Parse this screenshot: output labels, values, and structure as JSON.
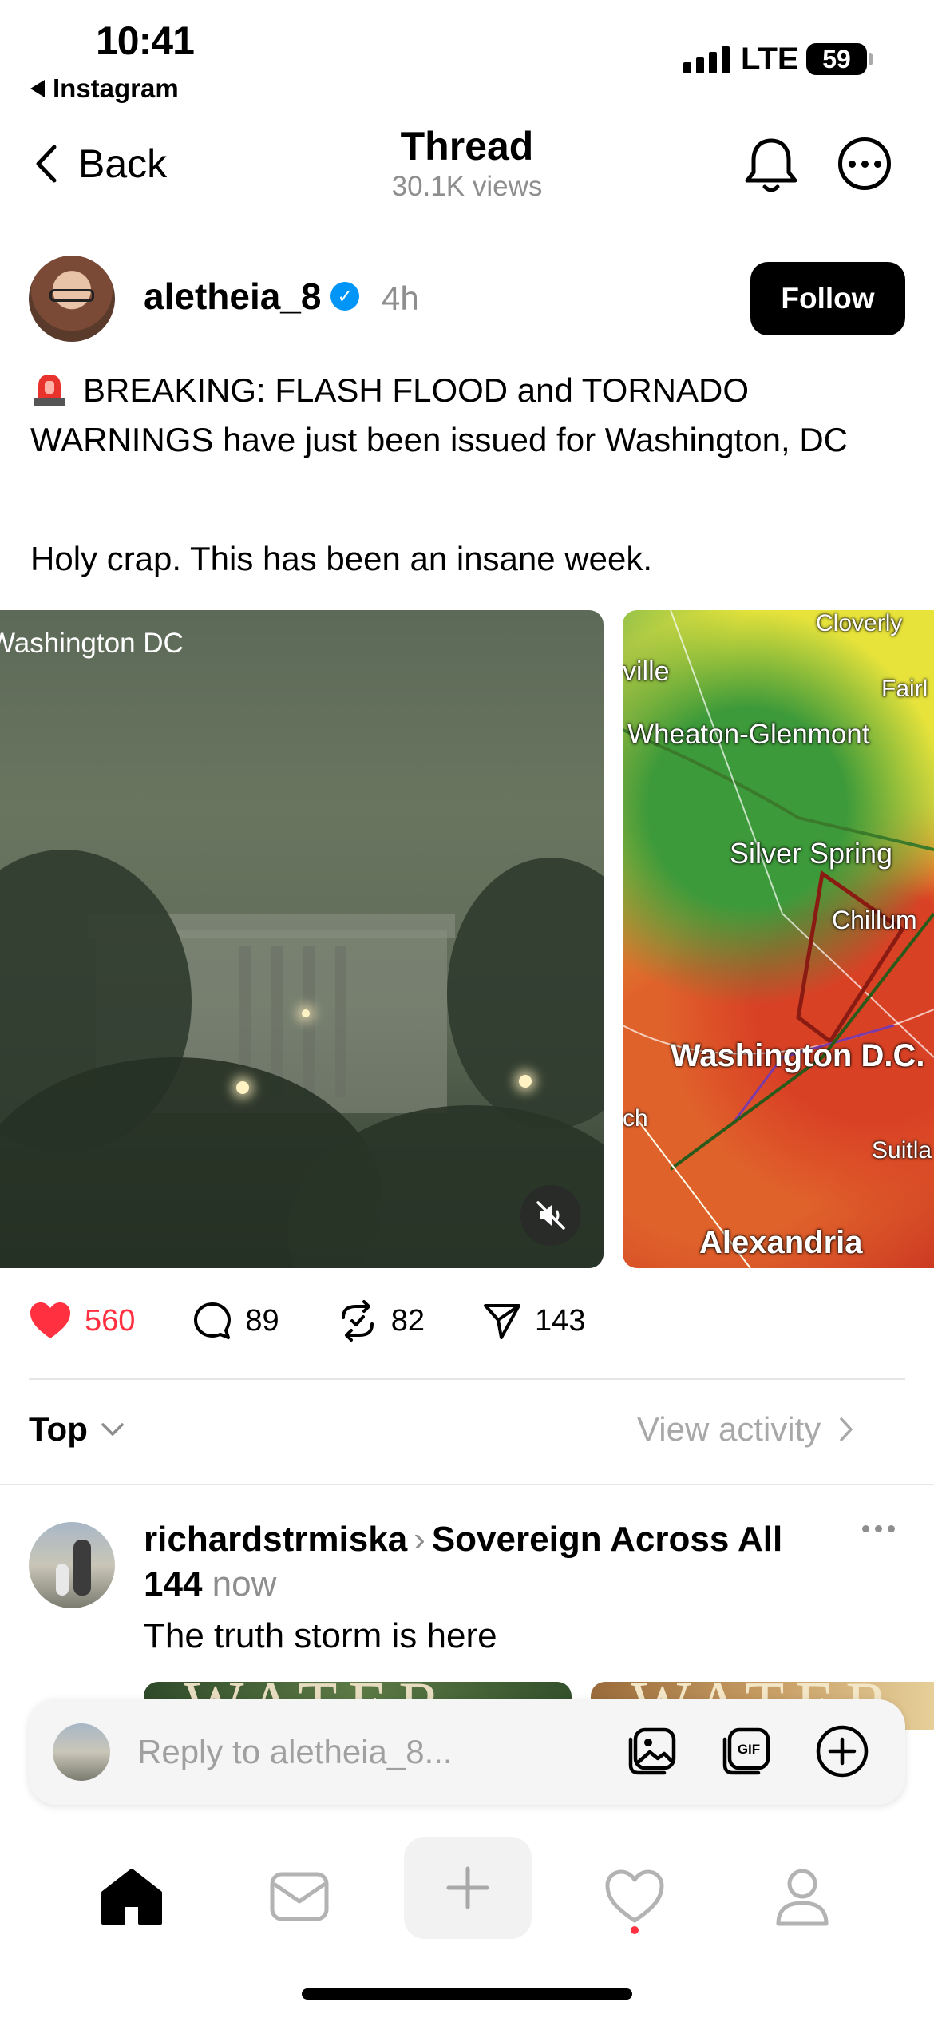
{
  "status_bar": {
    "time": "10:41",
    "back_app": "Instagram",
    "network": "LTE",
    "battery": "59"
  },
  "header": {
    "back_label": "Back",
    "title": "Thread",
    "views": "30.1K views"
  },
  "post": {
    "author": "aletheia_8",
    "time": "4h",
    "follow_label": "Follow",
    "text": "BREAKING: FLASH FLOOD and TORNADO WARNINGS have just been issued for Washington, DC",
    "text2": "Holy crap. This has been an insane week.",
    "media": [
      {
        "caption": "Washington DC"
      },
      {
        "labels": [
          "Cloverly",
          "ville",
          "Fairl",
          "Wheaton-Glenmont",
          "Silver Spring",
          "Chillum",
          "Washington D.C.",
          "ch",
          "Suitla",
          "Alexandria"
        ]
      }
    ],
    "stats": {
      "likes": "560",
      "comments": "89",
      "reposts": "82",
      "shares": "143"
    }
  },
  "sort": {
    "label": "Top",
    "view_activity": "View activity"
  },
  "reply": {
    "user": "richardstrmiska",
    "community": "Sovereign Across All 144",
    "time": "now",
    "text": "The truth storm is here",
    "thumb_text": "WATER"
  },
  "composer": {
    "placeholder": "Reply to aletheia_8..."
  },
  "colors": {
    "like": "#ff3040",
    "verified": "#0095f6",
    "muted": "#8e8e8e"
  }
}
